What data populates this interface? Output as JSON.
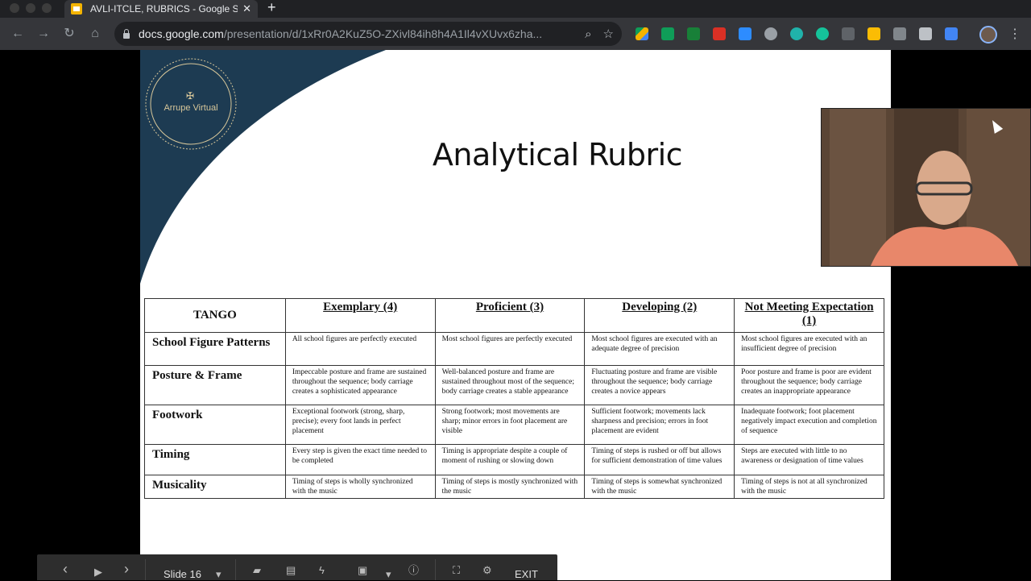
{
  "browser": {
    "tab_title": "AVLI-ITCLE, RUBRICS - Google Slides",
    "tab_close": "✕",
    "new_tab": "+",
    "url_host": "docs.google.com",
    "url_path": "/presentation/d/1xRr0A2KuZ5O-ZXivl84ih8h4A1Il4vXUvx6zha..."
  },
  "slide": {
    "logo_text": "Arrupe Virtual",
    "title": "Analytical Rubric",
    "table": {
      "corner": "TANGO",
      "columns": [
        "Exemplary (4)",
        "Proficient (3)",
        "Developing (2)",
        "Not Meeting Expectation (1)"
      ],
      "rows": [
        {
          "criterion": "School Figure Patterns",
          "cells": [
            "All school figures are perfectly executed",
            "Most school figures are perfectly executed",
            "Most school figures are executed with an adequate degree of precision",
            "Most school figures are executed with an insufficient degree of precision"
          ]
        },
        {
          "criterion": "Posture & Frame",
          "cells": [
            "Impeccable posture and frame are sustained throughout the sequence; body carriage creates a sophisticated appearance",
            "Well-balanced posture and frame are sustained throughout most of the sequence; body carriage creates a stable appearance",
            "Fluctuating posture and frame are visible throughout the sequence; body carriage creates a novice appears",
            "Poor posture and frame is poor are evident throughout the sequence; body carriage creates an inappropriate appearance"
          ]
        },
        {
          "criterion": "Footwork",
          "cells": [
            "Exceptional footwork (strong, sharp, precise); every foot lands in perfect placement",
            "Strong footwork; most movements are sharp; minor errors in foot placement are visible",
            "Sufficient footwork; movements lack sharpness and precision; errors in foot placement are evident",
            "Inadequate footwork; foot placement negatively impact execution and completion of sequence"
          ]
        },
        {
          "criterion": "Timing",
          "cells": [
            "Every step is given the exact time needed to be completed",
            "Timing is appropriate despite a couple of moment of rushing or slowing down",
            "Timing of steps is rushed or off but allows for sufficient demonstration of time values",
            "Steps are executed with little to no awareness or designation of time values"
          ]
        },
        {
          "criterion": "Musicality",
          "cells": [
            "Timing of steps is wholly synchronized with the music",
            "Timing of steps is mostly synchronized with the music",
            "Timing of steps is somewhat synchronized with the music",
            "Timing of steps is not at all synchronized with the music"
          ]
        }
      ]
    }
  },
  "presenter": {
    "prev": "‹",
    "play": "▶",
    "next": "›",
    "slide_label": "Slide 16",
    "dropdown": "▾",
    "exit": "EXIT"
  },
  "icons": {
    "back": "back-arrow-icon",
    "forward": "forward-arrow-icon",
    "reload": "reload-icon",
    "home": "home-icon",
    "search": "search-icon",
    "star": "bookmark-star-icon"
  },
  "colors": {
    "slide_accent": "#1d3b52",
    "gold": "#d8c79a"
  }
}
